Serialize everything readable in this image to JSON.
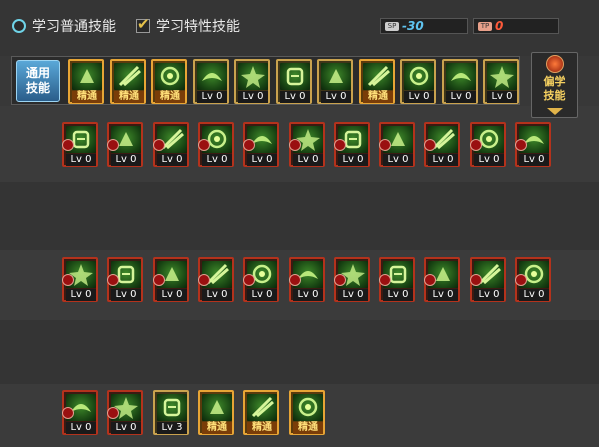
{
  "tabs": [
    {
      "label": "学习普通技能",
      "kind": "radio",
      "selected": false
    },
    {
      "label": "学习特性技能",
      "kind": "check",
      "selected": true
    }
  ],
  "sp_boxes": [
    {
      "tag": "SP",
      "value": "-30",
      "color": "#5fc4f0"
    },
    {
      "tag": "TP",
      "value": "0",
      "color": "#ff5a3a"
    }
  ],
  "common_panel": {
    "label_line1": "通用",
    "label_line2": "技能"
  },
  "side_button": {
    "line1": "偏学",
    "line2": "技能"
  },
  "skills": {
    "row_common": [
      {
        "level": "精通",
        "style": "m",
        "icon": "sitting-figure-icon"
      },
      {
        "level": "精通",
        "style": "m",
        "icon": "running-figure-icon"
      },
      {
        "level": "精通",
        "style": "m",
        "icon": "dash-figure-icon"
      },
      {
        "level": "Lv 0",
        "style": "g",
        "icon": "wings-icon"
      },
      {
        "level": "Lv 0",
        "style": "g",
        "icon": "target-icon"
      },
      {
        "level": "Lv 0",
        "style": "g",
        "icon": "target-burst-icon"
      },
      {
        "level": "Lv 0",
        "style": "g",
        "icon": "kneeling-figure-icon"
      },
      {
        "level": "精通",
        "style": "m",
        "icon": "meditation-icon"
      },
      {
        "level": "Lv 0",
        "style": "g",
        "icon": "vortex-icon"
      },
      {
        "level": "Lv 0",
        "style": "g",
        "icon": "muscle-figure-icon"
      },
      {
        "level": "Lv 0",
        "style": "g",
        "icon": "slash-icon"
      }
    ],
    "row1": [
      {
        "level": "Lv 0",
        "style": "r",
        "icon": "runner-icon"
      },
      {
        "level": "Lv 0",
        "style": "r",
        "icon": "spear-icon"
      },
      {
        "level": "Lv 0",
        "style": "r",
        "icon": "claw-icon"
      },
      {
        "level": "Lv 0",
        "style": "r",
        "icon": "helmet-icon"
      },
      {
        "level": "Lv 0",
        "style": "r",
        "icon": "gear-burst-icon"
      },
      {
        "level": "Lv 0",
        "style": "r",
        "icon": "arrow-rush-icon"
      },
      {
        "level": "Lv 0",
        "style": "r",
        "icon": "split-icon"
      },
      {
        "level": "Lv 0",
        "style": "r",
        "icon": "drill-icon"
      },
      {
        "level": "Lv 0",
        "style": "r",
        "icon": "crossed-blades-icon"
      },
      {
        "level": "Lv 0",
        "style": "r",
        "icon": "sword-icon"
      },
      {
        "level": "Lv 0",
        "style": "r",
        "icon": "figure-strike-icon"
      }
    ],
    "row2": [
      {
        "level": "Lv 0",
        "style": "r",
        "icon": "skull-icon"
      },
      {
        "level": "Lv 0",
        "style": "r",
        "icon": "explosion-icon"
      },
      {
        "level": "Lv 0",
        "style": "r",
        "icon": "fist-icon"
      },
      {
        "level": "Lv 0",
        "style": "r",
        "icon": "demon-face-icon"
      },
      {
        "level": "Lv 0",
        "style": "r",
        "icon": "whirl-icon"
      },
      {
        "level": "Lv 0",
        "style": "r",
        "icon": "jaws-icon"
      },
      {
        "level": "Lv 0",
        "style": "r",
        "icon": "shield-strike-icon"
      },
      {
        "level": "Lv 0",
        "style": "r",
        "icon": "blade-icon"
      },
      {
        "level": "Lv 0",
        "style": "r",
        "icon": "spiral-icon"
      },
      {
        "level": "Lv 0",
        "style": "r",
        "icon": "cross-slash-icon"
      },
      {
        "level": "Lv 0",
        "style": "r",
        "icon": "wind-cut-icon"
      }
    ],
    "row3": [
      {
        "level": "Lv 0",
        "style": "r",
        "icon": "chain-icon"
      },
      {
        "level": "Lv 0",
        "style": "r",
        "icon": "twin-blades-icon"
      },
      {
        "level": "Lv 3",
        "style": "g",
        "icon": "energy-burst-icon"
      },
      {
        "level": "精通",
        "style": "m",
        "icon": "scroll-icon"
      },
      {
        "level": "精通",
        "style": "m",
        "icon": "golem-icon"
      },
      {
        "level": "精通",
        "style": "m",
        "icon": "leaf-blade-icon"
      }
    ]
  }
}
